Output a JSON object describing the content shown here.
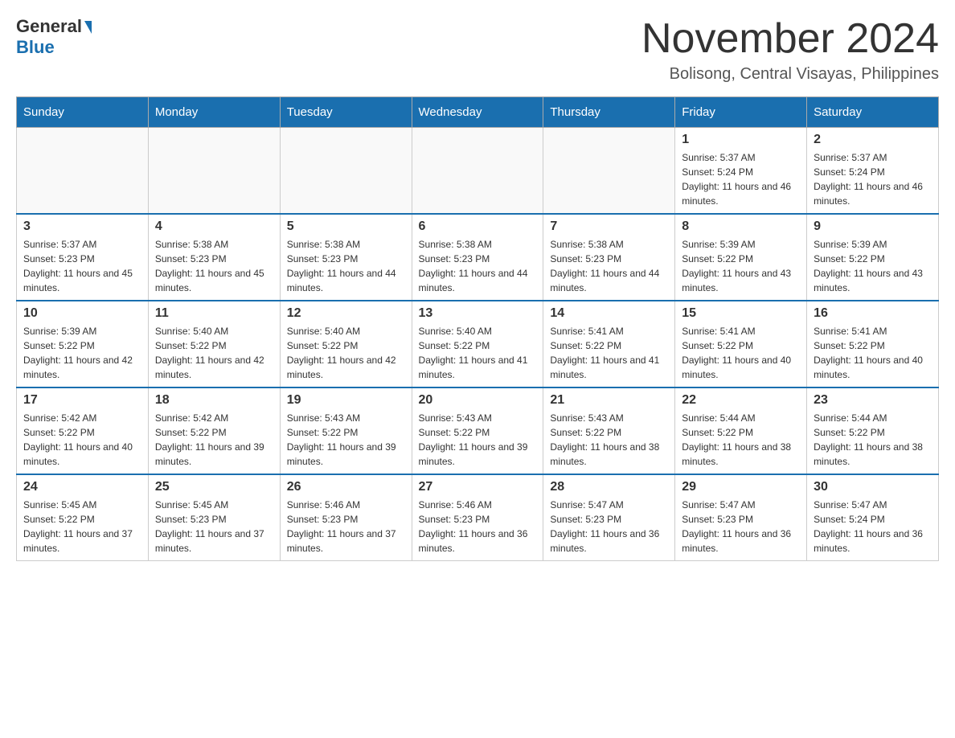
{
  "header": {
    "logo_general": "General",
    "logo_blue": "Blue",
    "title": "November 2024",
    "subtitle": "Bolisong, Central Visayas, Philippines"
  },
  "days_of_week": [
    "Sunday",
    "Monday",
    "Tuesday",
    "Wednesday",
    "Thursday",
    "Friday",
    "Saturday"
  ],
  "weeks": [
    [
      {
        "day": "",
        "info": ""
      },
      {
        "day": "",
        "info": ""
      },
      {
        "day": "",
        "info": ""
      },
      {
        "day": "",
        "info": ""
      },
      {
        "day": "",
        "info": ""
      },
      {
        "day": "1",
        "info": "Sunrise: 5:37 AM\nSunset: 5:24 PM\nDaylight: 11 hours and 46 minutes."
      },
      {
        "day": "2",
        "info": "Sunrise: 5:37 AM\nSunset: 5:24 PM\nDaylight: 11 hours and 46 minutes."
      }
    ],
    [
      {
        "day": "3",
        "info": "Sunrise: 5:37 AM\nSunset: 5:23 PM\nDaylight: 11 hours and 45 minutes."
      },
      {
        "day": "4",
        "info": "Sunrise: 5:38 AM\nSunset: 5:23 PM\nDaylight: 11 hours and 45 minutes."
      },
      {
        "day": "5",
        "info": "Sunrise: 5:38 AM\nSunset: 5:23 PM\nDaylight: 11 hours and 44 minutes."
      },
      {
        "day": "6",
        "info": "Sunrise: 5:38 AM\nSunset: 5:23 PM\nDaylight: 11 hours and 44 minutes."
      },
      {
        "day": "7",
        "info": "Sunrise: 5:38 AM\nSunset: 5:23 PM\nDaylight: 11 hours and 44 minutes."
      },
      {
        "day": "8",
        "info": "Sunrise: 5:39 AM\nSunset: 5:22 PM\nDaylight: 11 hours and 43 minutes."
      },
      {
        "day": "9",
        "info": "Sunrise: 5:39 AM\nSunset: 5:22 PM\nDaylight: 11 hours and 43 minutes."
      }
    ],
    [
      {
        "day": "10",
        "info": "Sunrise: 5:39 AM\nSunset: 5:22 PM\nDaylight: 11 hours and 42 minutes."
      },
      {
        "day": "11",
        "info": "Sunrise: 5:40 AM\nSunset: 5:22 PM\nDaylight: 11 hours and 42 minutes."
      },
      {
        "day": "12",
        "info": "Sunrise: 5:40 AM\nSunset: 5:22 PM\nDaylight: 11 hours and 42 minutes."
      },
      {
        "day": "13",
        "info": "Sunrise: 5:40 AM\nSunset: 5:22 PM\nDaylight: 11 hours and 41 minutes."
      },
      {
        "day": "14",
        "info": "Sunrise: 5:41 AM\nSunset: 5:22 PM\nDaylight: 11 hours and 41 minutes."
      },
      {
        "day": "15",
        "info": "Sunrise: 5:41 AM\nSunset: 5:22 PM\nDaylight: 11 hours and 40 minutes."
      },
      {
        "day": "16",
        "info": "Sunrise: 5:41 AM\nSunset: 5:22 PM\nDaylight: 11 hours and 40 minutes."
      }
    ],
    [
      {
        "day": "17",
        "info": "Sunrise: 5:42 AM\nSunset: 5:22 PM\nDaylight: 11 hours and 40 minutes."
      },
      {
        "day": "18",
        "info": "Sunrise: 5:42 AM\nSunset: 5:22 PM\nDaylight: 11 hours and 39 minutes."
      },
      {
        "day": "19",
        "info": "Sunrise: 5:43 AM\nSunset: 5:22 PM\nDaylight: 11 hours and 39 minutes."
      },
      {
        "day": "20",
        "info": "Sunrise: 5:43 AM\nSunset: 5:22 PM\nDaylight: 11 hours and 39 minutes."
      },
      {
        "day": "21",
        "info": "Sunrise: 5:43 AM\nSunset: 5:22 PM\nDaylight: 11 hours and 38 minutes."
      },
      {
        "day": "22",
        "info": "Sunrise: 5:44 AM\nSunset: 5:22 PM\nDaylight: 11 hours and 38 minutes."
      },
      {
        "day": "23",
        "info": "Sunrise: 5:44 AM\nSunset: 5:22 PM\nDaylight: 11 hours and 38 minutes."
      }
    ],
    [
      {
        "day": "24",
        "info": "Sunrise: 5:45 AM\nSunset: 5:22 PM\nDaylight: 11 hours and 37 minutes."
      },
      {
        "day": "25",
        "info": "Sunrise: 5:45 AM\nSunset: 5:23 PM\nDaylight: 11 hours and 37 minutes."
      },
      {
        "day": "26",
        "info": "Sunrise: 5:46 AM\nSunset: 5:23 PM\nDaylight: 11 hours and 37 minutes."
      },
      {
        "day": "27",
        "info": "Sunrise: 5:46 AM\nSunset: 5:23 PM\nDaylight: 11 hours and 36 minutes."
      },
      {
        "day": "28",
        "info": "Sunrise: 5:47 AM\nSunset: 5:23 PM\nDaylight: 11 hours and 36 minutes."
      },
      {
        "day": "29",
        "info": "Sunrise: 5:47 AM\nSunset: 5:23 PM\nDaylight: 11 hours and 36 minutes."
      },
      {
        "day": "30",
        "info": "Sunrise: 5:47 AM\nSunset: 5:24 PM\nDaylight: 11 hours and 36 minutes."
      }
    ]
  ]
}
